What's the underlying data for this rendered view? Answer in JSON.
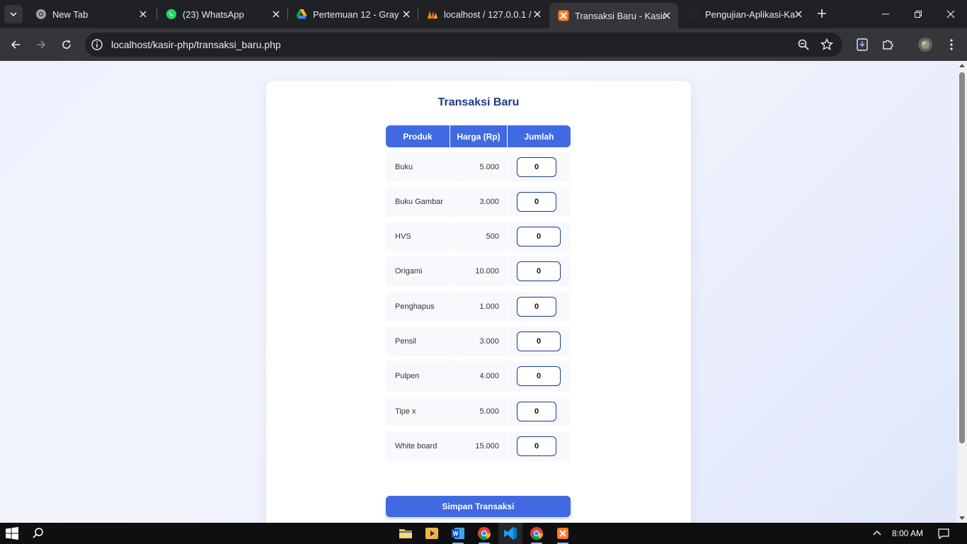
{
  "browser": {
    "tabs": [
      {
        "title": "New Tab",
        "icon": "chrome-icon"
      },
      {
        "title": "(23) WhatsApp",
        "icon": "whatsapp-icon"
      },
      {
        "title": "Pertemuan 12 - Gray",
        "icon": "google-drive-icon"
      },
      {
        "title": "localhost / 127.0.0.1 /",
        "icon": "phpmyadmin-icon"
      },
      {
        "title": "Transaksi Baru - Kasir",
        "icon": "xampp-icon",
        "active": true
      },
      {
        "title": "Pengujian-Aplikasi-Ka",
        "icon": "github-icon"
      }
    ],
    "url": "localhost/kasir-php/transaksi_baru.php"
  },
  "page": {
    "title": "Transaksi Baru",
    "columns": [
      "Produk",
      "Harga (Rp)",
      "Jumlah"
    ],
    "rows": [
      {
        "produk": "Buku",
        "harga": "5.000",
        "jumlah": "0"
      },
      {
        "produk": "Buku Gambar",
        "harga": "3.000",
        "jumlah": "0"
      },
      {
        "produk": "HVS",
        "harga": "500",
        "jumlah": "0"
      },
      {
        "produk": "Origami",
        "harga": "10.000",
        "jumlah": "0"
      },
      {
        "produk": "Penghapus",
        "harga": "1.000",
        "jumlah": "0"
      },
      {
        "produk": "Pensil",
        "harga": "3.000",
        "jumlah": "0"
      },
      {
        "produk": "Pulpen",
        "harga": "4.000",
        "jumlah": "0"
      },
      {
        "produk": "Tipe x",
        "harga": "5.000",
        "jumlah": "0"
      },
      {
        "produk": "White board",
        "harga": "15.000",
        "jumlah": "0"
      }
    ],
    "submit_label": "Simpan Transaksi"
  },
  "taskbar": {
    "apps": [
      "file-explorer-icon",
      "media-player-icon",
      "word-icon",
      "chrome-icon",
      "vscode-icon",
      "chrome-icon",
      "xampp-icon"
    ],
    "time": "8:00 AM"
  },
  "colors": {
    "accent": "#4169e1",
    "title": "#1e3a8a",
    "row_bg": "#f8f9fc"
  }
}
